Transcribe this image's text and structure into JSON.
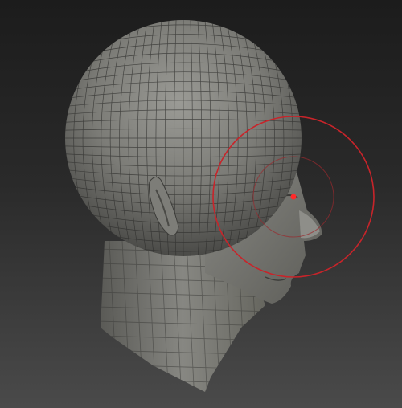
{
  "viewport": {
    "model": "head-sculpt-wireframe",
    "background": "#2a2a2a",
    "mesh_color": "#7a7a76",
    "wire_color": "#2e2e2c",
    "brush_cursor_color": "#c8242a",
    "brush_focal_color": "#ff2a2a"
  }
}
